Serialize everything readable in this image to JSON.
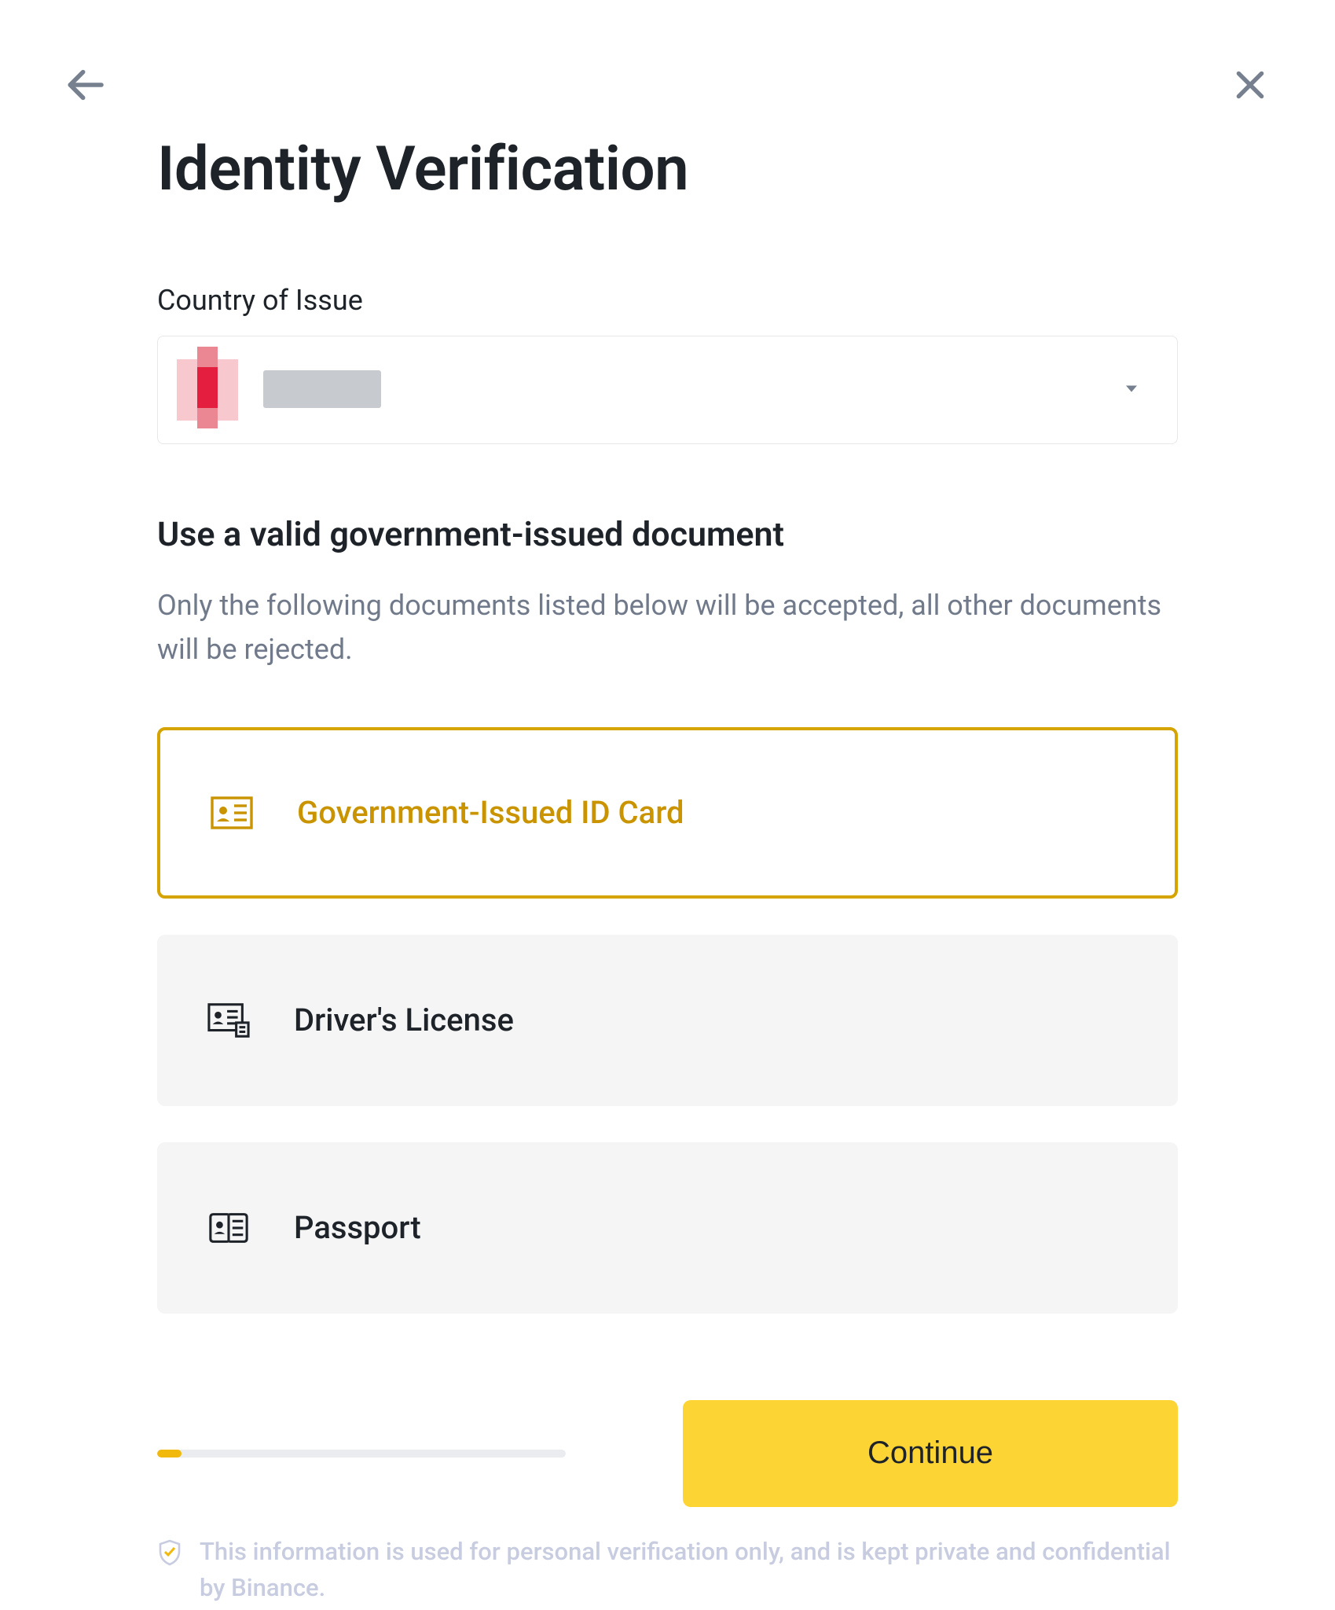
{
  "header": {
    "title": "Identity Verification"
  },
  "country": {
    "label": "Country of Issue",
    "selected_redacted": true
  },
  "documents": {
    "section_title": "Use a valid government-issued document",
    "section_desc": "Only the following documents listed below will be accepted, all other documents will be rejected.",
    "options": [
      {
        "label": "Government-Issued ID Card",
        "selected": true
      },
      {
        "label": "Driver's License",
        "selected": false
      },
      {
        "label": "Passport",
        "selected": false
      }
    ]
  },
  "progress": {
    "percent": 6
  },
  "actions": {
    "continue_label": "Continue"
  },
  "disclaimer": {
    "text": "This information is used for personal verification only, and is kept private and confidential by Binance."
  },
  "colors": {
    "accent": "#fcd535",
    "accent_border": "#d6a400",
    "text_primary": "#1e2329",
    "text_secondary": "#707a8a"
  }
}
